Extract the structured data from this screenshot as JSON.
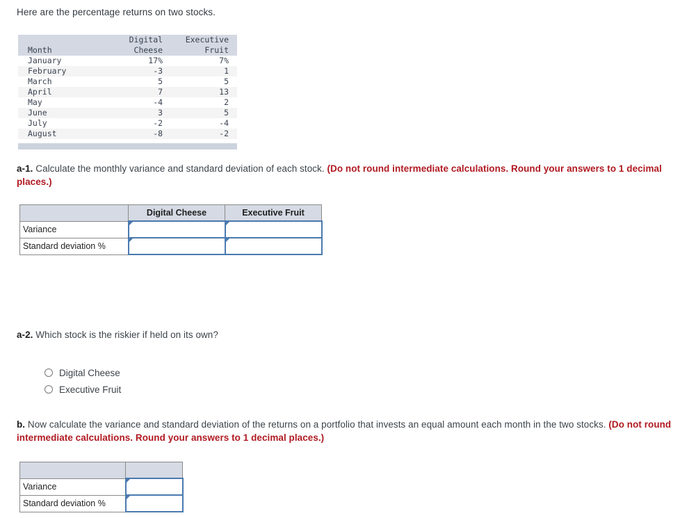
{
  "intro": {
    "text": "Here are the percentage returns on two stocks."
  },
  "returns_table": {
    "headers": {
      "month": "Month",
      "stock1_line1": "Digital",
      "stock1_line2": "Cheese",
      "stock2_line1": "Executive",
      "stock2_line2": "Fruit"
    },
    "rows": [
      {
        "month": "January",
        "digital_cheese": "17%",
        "executive_fruit": "7%"
      },
      {
        "month": "February",
        "digital_cheese": "-3",
        "executive_fruit": "1"
      },
      {
        "month": "March",
        "digital_cheese": "5",
        "executive_fruit": "5"
      },
      {
        "month": "April",
        "digital_cheese": "7",
        "executive_fruit": "13"
      },
      {
        "month": "May",
        "digital_cheese": "-4",
        "executive_fruit": "2"
      },
      {
        "month": "June",
        "digital_cheese": "3",
        "executive_fruit": "5"
      },
      {
        "month": "July",
        "digital_cheese": "-2",
        "executive_fruit": "-4"
      },
      {
        "month": "August",
        "digital_cheese": "-8",
        "executive_fruit": "-2"
      }
    ]
  },
  "question_a1": {
    "label": "a-1.",
    "body": " Calculate the monthly variance and standard deviation of each stock. ",
    "hint": "(Do not round intermediate calculations. Round your answers to 1 decimal places.)"
  },
  "answer_table_a1": {
    "headers": [
      "",
      "Digital Cheese",
      "Executive Fruit"
    ],
    "rows": [
      {
        "label": "Variance",
        "digital_cheese": "",
        "executive_fruit": ""
      },
      {
        "label": "Standard deviation %",
        "digital_cheese": "",
        "executive_fruit": ""
      }
    ]
  },
  "question_a2": {
    "label": "a-2.",
    "body": " Which stock is the riskier if held on its own?",
    "options": [
      {
        "label": "Digital Cheese",
        "selected": false
      },
      {
        "label": "Executive Fruit",
        "selected": false
      }
    ]
  },
  "question_b": {
    "label": "b.",
    "body": " Now calculate the variance and standard deviation of the  returns on a portfolio that invests an equal amount each month in the two stocks. ",
    "hint": "(Do not round intermediate calculations. Round your answers to 1 decimal places.)"
  },
  "answer_table_b": {
    "headers": [
      "",
      ""
    ],
    "rows": [
      {
        "label": "Variance",
        "value": ""
      },
      {
        "label": "Standard deviation %",
        "value": ""
      }
    ]
  },
  "colors": {
    "hint_red": "#b01a22",
    "header_fill": "#d5dae4",
    "data_header_fill": "#d3d8e2",
    "input_border": "#4a7ab0",
    "stripe": "#f4f4f4"
  }
}
